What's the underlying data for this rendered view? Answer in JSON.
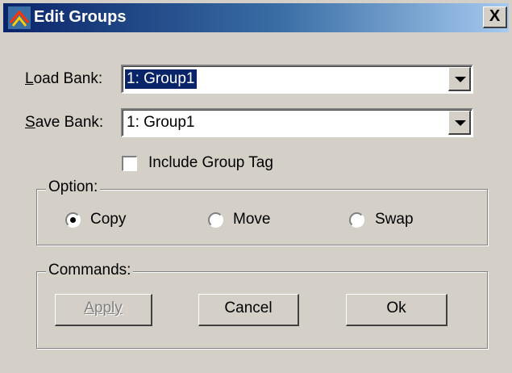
{
  "window": {
    "title": "Edit Groups",
    "close_label": "X"
  },
  "load_bank": {
    "label": "Load Bank:",
    "value": "1: Group1"
  },
  "save_bank": {
    "label": "Save Bank:",
    "value": "1: Group1"
  },
  "include_group_tag": {
    "label": "Include Group Tag",
    "checked": false
  },
  "option": {
    "title": "Option:",
    "choices": [
      {
        "label": "Copy",
        "selected": true
      },
      {
        "label": "Move",
        "selected": false
      },
      {
        "label": "Swap",
        "selected": false
      }
    ]
  },
  "commands": {
    "title": "Commands:",
    "apply_label": "Apply",
    "apply_enabled": false,
    "cancel_label": "Cancel",
    "ok_label": "Ok"
  }
}
